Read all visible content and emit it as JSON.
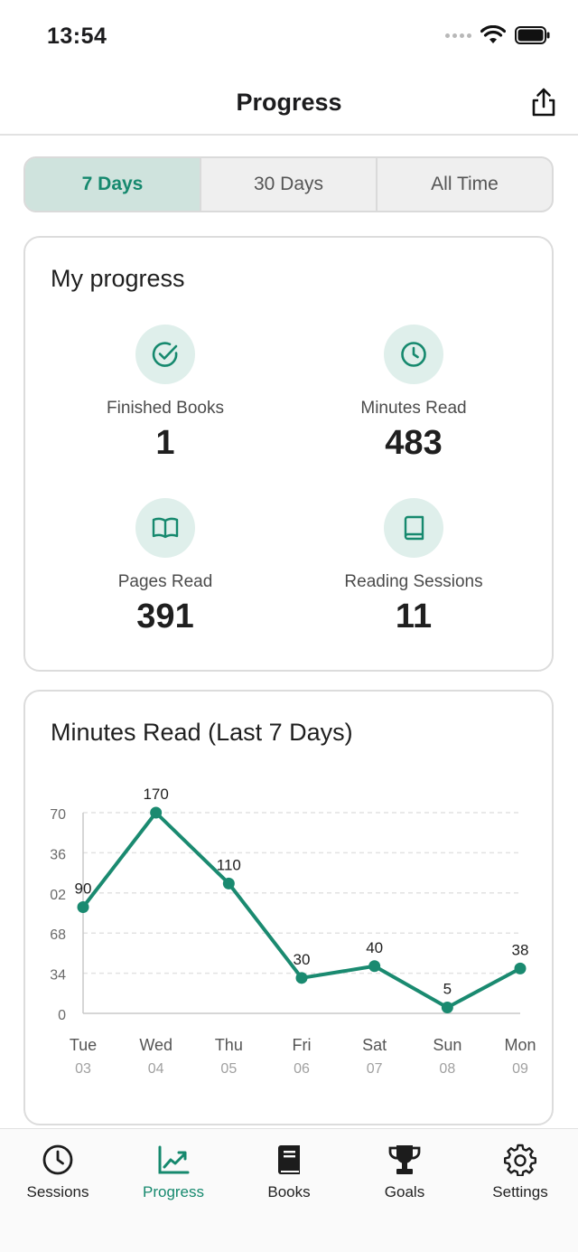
{
  "status_bar": {
    "time": "13:54"
  },
  "nav": {
    "title": "Progress"
  },
  "range_tabs": [
    {
      "label": "7 Days",
      "active": true
    },
    {
      "label": "30 Days",
      "active": false
    },
    {
      "label": "All Time",
      "active": false
    }
  ],
  "progress_card": {
    "title": "My progress",
    "stats": [
      {
        "label": "Finished Books",
        "value": "1",
        "icon": "check-circle-icon"
      },
      {
        "label": "Minutes Read",
        "value": "483",
        "icon": "clock-icon"
      },
      {
        "label": "Pages Read",
        "value": "391",
        "icon": "open-book-icon"
      },
      {
        "label": "Reading Sessions",
        "value": "11",
        "icon": "book-icon"
      }
    ]
  },
  "chart_card": {
    "title": "Minutes Read (Last 7 Days)"
  },
  "chart_data": {
    "type": "line",
    "categories": [
      "Tue",
      "Wed",
      "Thu",
      "Fri",
      "Sat",
      "Sun",
      "Mon"
    ],
    "category_sublabels": [
      "03",
      "04",
      "05",
      "06",
      "07",
      "08",
      "09"
    ],
    "values": [
      90,
      170,
      110,
      30,
      40,
      5,
      38
    ],
    "y_tick_labels": [
      "0",
      "34",
      "68",
      "02",
      "36",
      "70"
    ],
    "ylim": [
      0,
      170
    ],
    "grid": true,
    "color": "#1a8a70"
  },
  "tab_bar": [
    {
      "label": "Sessions",
      "icon": "clock-icon",
      "active": false
    },
    {
      "label": "Progress",
      "icon": "chart-icon",
      "active": true
    },
    {
      "label": "Books",
      "icon": "book-icon",
      "active": false
    },
    {
      "label": "Goals",
      "icon": "trophy-icon",
      "active": false
    },
    {
      "label": "Settings",
      "icon": "gear-icon",
      "active": false
    }
  ],
  "colors": {
    "accent": "#16896e",
    "accent_light": "#dfefeb",
    "tab_active_bg": "#cfe3dd"
  }
}
